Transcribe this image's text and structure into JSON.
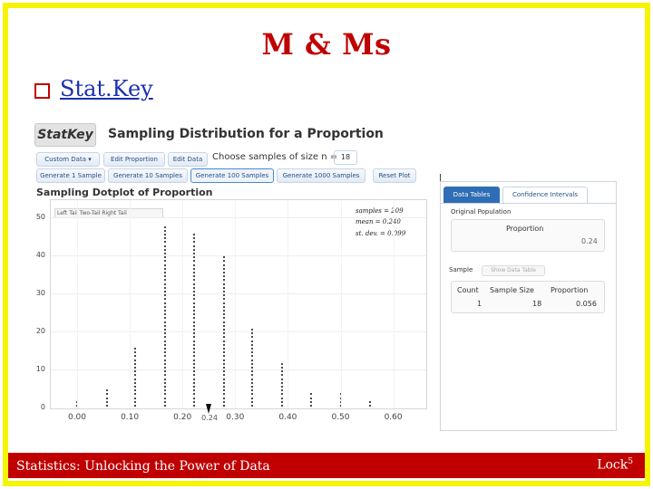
{
  "slide": {
    "title": "M & Ms",
    "bullet_link": "Stat.Key",
    "footer_left": "Statistics: Unlocking the Power of Data",
    "footer_right": "Lock",
    "footer_sup": "5",
    "colors": {
      "border": "#f5f500",
      "accent": "#c00000",
      "link": "#1a2fb0"
    }
  },
  "app": {
    "logo": "StatKey",
    "title": "Sampling Distribution for a Proportion",
    "buttons_row1": [
      "Custom Data ▾",
      "Edit Proportion",
      "Edit Data"
    ],
    "sample_size_label": "Choose samples of size n =",
    "sample_size_value": "18",
    "buttons_row2": [
      "Generate 1 Sample",
      "Generate 10 Samples",
      "Generate 100 Samples",
      "Generate 1000 Samples",
      "Reset Plot"
    ],
    "plot_title": "Sampling Dotplot of Proportion",
    "tail_options": "Left Tail  Two-Tail  Right Tail",
    "stats": [
      "samples = 209",
      "mean = 0.240",
      "st. dev. = 0.099"
    ],
    "marker_label": "0.24"
  },
  "chart_data": {
    "type": "scatter",
    "title": "Sampling Dotplot of Proportion",
    "xlabel": "",
    "ylabel": "",
    "x_ticks": [
      "0.00",
      "0.10",
      "0.20",
      "0.30",
      "0.40",
      "0.50",
      "0.60"
    ],
    "y_ticks": [
      "0",
      "10",
      "20",
      "30",
      "40",
      "50"
    ],
    "xlim": [
      -0.02,
      0.66
    ],
    "ylim": [
      0,
      50
    ],
    "x": [
      0.0,
      0.056,
      0.111,
      0.167,
      0.222,
      0.278,
      0.333,
      0.389,
      0.444,
      0.5,
      0.556
    ],
    "counts": [
      2,
      5,
      16,
      48,
      46,
      40,
      21,
      12,
      4,
      4,
      2
    ],
    "total_samples": 209,
    "mean": 0.24,
    "sd": 0.099,
    "grid": true
  },
  "panel": {
    "tabs": [
      "Data Tables",
      "Confidence Intervals"
    ],
    "original_population_label": "Original Population",
    "proportion_label": "Proportion",
    "proportion_value": "0.24",
    "sample_label": "Sample",
    "show_table_button": "Show Data Table",
    "table_headers": [
      "Count",
      "Sample Size",
      "Proportion"
    ],
    "table_row": [
      "1",
      "18",
      "0.056"
    ]
  }
}
